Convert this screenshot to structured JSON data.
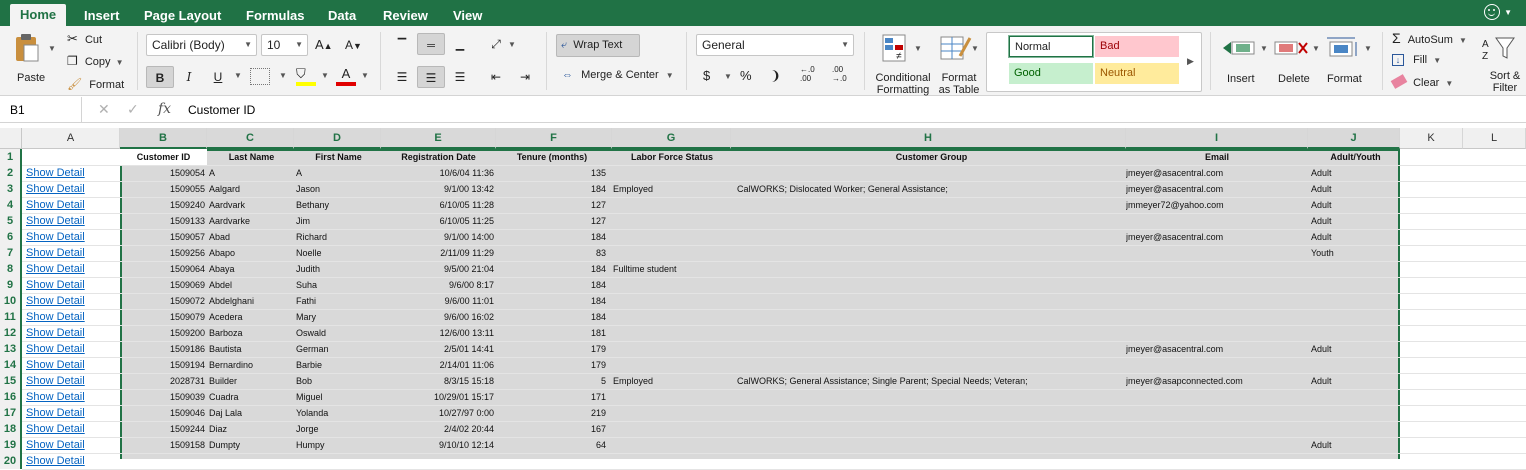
{
  "tabs": [
    "Home",
    "Insert",
    "Page Layout",
    "Formulas",
    "Data",
    "Review",
    "View"
  ],
  "clipboard": {
    "paste": "Paste",
    "cut": "Cut",
    "copy": "Copy",
    "format": "Format"
  },
  "font": {
    "name": "Calibri (Body)",
    "size": "10",
    "bold": "B",
    "italic": "I",
    "underline": "U"
  },
  "alignment": {
    "wrap_text": "Wrap Text",
    "merge_center": "Merge & Center"
  },
  "number": {
    "format": "General",
    "currency": "$",
    "percent": "%",
    "comma": "❩",
    "inc_decimal": "←.0\n.00",
    "dec_decimal": ".00\n→.0"
  },
  "styles": {
    "conditional_formatting": "Conditional Formatting",
    "format_as_table": "Format as Table",
    "normal": "Normal",
    "bad": "Bad",
    "good": "Good",
    "neutral": "Neutral"
  },
  "cells": {
    "insert": "Insert",
    "delete": "Delete",
    "format": "Format"
  },
  "editing": {
    "autosum": "AutoSum",
    "fill": "Fill",
    "clear": "Clear",
    "sort_filter": "Sort & Filter"
  },
  "formula_bar": {
    "name_box": "B1",
    "fx": "fx",
    "value": "Customer ID"
  },
  "columns": [
    "A",
    "B",
    "C",
    "D",
    "E",
    "F",
    "G",
    "H",
    "I",
    "J",
    "K",
    "L"
  ],
  "headers": [
    "Customer ID",
    "Last Name",
    "First Name",
    "Registration Date",
    "Tenure (months)",
    "Labor Force Status",
    "Customer Group",
    "Email",
    "Adult/Youth"
  ],
  "link_text": "Show Detail",
  "rows": [
    [
      "1509054",
      "A",
      "A",
      "10/6/04 11:36",
      "135",
      "",
      "",
      "jmeyer@asacentral.com",
      "Adult"
    ],
    [
      "1509055",
      "Aalgard",
      "Jason",
      "9/1/00 13:42",
      "184",
      "Employed",
      "CalWORKS; Dislocated Worker; General Assistance;",
      "jmeyer@asacentral.com",
      "Adult"
    ],
    [
      "1509240",
      "Aardvark",
      "Bethany",
      "6/10/05 11:28",
      "127",
      "",
      "",
      "jmmeyer72@yahoo.com",
      "Adult"
    ],
    [
      "1509133",
      "Aardvarke",
      "Jim",
      "6/10/05 11:25",
      "127",
      "",
      "",
      "",
      "Adult"
    ],
    [
      "1509057",
      "Abad",
      "Richard",
      "9/1/00 14:00",
      "184",
      "",
      "",
      "jmeyer@asacentral.com",
      "Adult"
    ],
    [
      "1509256",
      "Abapo",
      "Noelle",
      "2/11/09 11:29",
      "83",
      "",
      "",
      "",
      "Youth"
    ],
    [
      "1509064",
      "Abaya",
      "Judith",
      "9/5/00 21:04",
      "184",
      "Fulltime student",
      "",
      "",
      ""
    ],
    [
      "1509069",
      "Abdel",
      "Suha",
      "9/6/00 8:17",
      "184",
      "",
      "",
      "",
      ""
    ],
    [
      "1509072",
      "Abdelghani",
      "Fathi",
      "9/6/00 11:01",
      "184",
      "",
      "",
      "",
      ""
    ],
    [
      "1509079",
      "Acedera",
      "Mary",
      "9/6/00 16:02",
      "184",
      "",
      "",
      "",
      ""
    ],
    [
      "1509200",
      "Barboza",
      "Oswald",
      "12/6/00 13:11",
      "181",
      "",
      "",
      "",
      ""
    ],
    [
      "1509186",
      "Bautista",
      "German",
      "2/5/01 14:41",
      "179",
      "",
      "",
      "jmeyer@asacentral.com",
      "Adult"
    ],
    [
      "1509194",
      "Bernardino",
      "Barbie",
      "2/14/01 11:06",
      "179",
      "",
      "",
      "",
      ""
    ],
    [
      "2028731",
      "Builder",
      "Bob",
      "8/3/15 15:18",
      "5",
      "Employed",
      "CalWORKS; General Assistance; Single Parent; Special Needs; Veteran;",
      "jmeyer@asapconnected.com",
      "Adult"
    ],
    [
      "1509039",
      "Cuadra",
      "Miguel",
      "10/29/01 15:17",
      "171",
      "",
      "",
      "",
      ""
    ],
    [
      "1509046",
      "Daj Lala",
      "Yolanda",
      "10/27/97 0:00",
      "219",
      "",
      "",
      "",
      ""
    ],
    [
      "1509244",
      "Diaz",
      "Jorge",
      "2/4/02 20:44",
      "167",
      "",
      "",
      "",
      ""
    ],
    [
      "1509158",
      "Dumpty",
      "Humpy",
      "9/10/10 12:14",
      "64",
      "",
      "",
      "",
      "Adult"
    ]
  ],
  "row_numbers": [
    "1",
    "2",
    "3",
    "4",
    "5",
    "6",
    "7",
    "8",
    "9",
    "10",
    "11",
    "12",
    "13",
    "14",
    "15",
    "16",
    "17",
    "18",
    "19",
    "20"
  ]
}
